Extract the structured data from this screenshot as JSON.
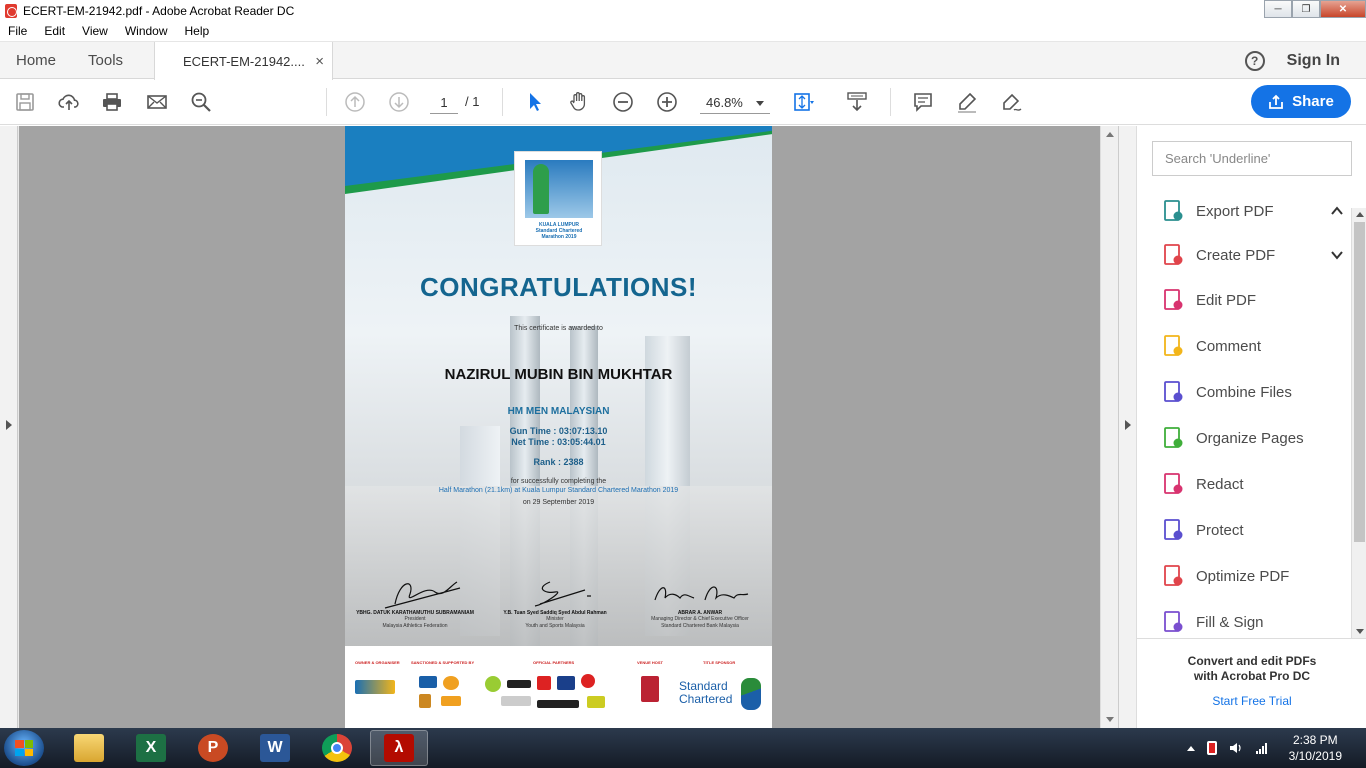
{
  "window": {
    "title": "ECERT-EM-21942.pdf - Adobe Acrobat Reader DC"
  },
  "menu": [
    "File",
    "Edit",
    "View",
    "Window",
    "Help"
  ],
  "tabs": {
    "home": "Home",
    "tools": "Tools",
    "doc": "ECERT-EM-21942....",
    "close": "×"
  },
  "header": {
    "help": "?",
    "signin": "Sign In"
  },
  "toolbar": {
    "page_current": "1",
    "page_total": "/ 1",
    "zoom": "46.8%",
    "share": "Share"
  },
  "certificate": {
    "logo_text": "KUALA LUMPUR\nStandard Chartered\nMarathon 2019",
    "headline": "CONGRATULATIONS!",
    "awarded": "This certificate is awarded to",
    "name": "NAZIRUL MUBIN BIN MUKHTAR",
    "category": "HM MEN MALAYSIAN",
    "gun_time": "Gun Time : 03:07:13.10",
    "net_time": "Net Time : 03:05:44.01",
    "rank": "Rank : 2388",
    "completing": "for successfully completing the",
    "event": "Half Marathon (21.1km) at Kuala Lumpur Standard Chartered Marathon 2019",
    "date": "on 29 September 2019",
    "signatories": [
      {
        "name": "YBHG. DATUK KARATHAMUTHU SUBRAMANIAM",
        "role1": "President",
        "role2": "Malaysia Athletics Federation"
      },
      {
        "name": "Y.B. Tuan Syed Saddiq Syed Abdul Rahman",
        "role1": "Minister",
        "role2": "Youth and Sports Malaysia"
      },
      {
        "name": "ABRAR A. ANWAR",
        "role1": "Managing Director & Chief Executive Officer",
        "role2": "Standard Chartered Bank Malaysia"
      }
    ],
    "sponsor_heads": [
      "OWNER & ORGANISER",
      "SANCTIONED & SUPPORTED BY",
      "OFFICIAL PARTNERS",
      "VENUE HOST",
      "TITLE SPONSOR"
    ],
    "sponsor_logo": "Standard\nChartered"
  },
  "right_panel": {
    "search_placeholder": "Search 'Underline'",
    "tools": [
      {
        "label": "Export PDF",
        "color": "#2a8f8f"
      },
      {
        "label": "Create PDF",
        "color": "#e0444b"
      },
      {
        "label": "Edit PDF",
        "color": "#d8336f"
      },
      {
        "label": "Comment",
        "color": "#f2b51a"
      },
      {
        "label": "Combine Files",
        "color": "#5a4fcf"
      },
      {
        "label": "Organize Pages",
        "color": "#3fae3a"
      },
      {
        "label": "Redact",
        "color": "#d8336f"
      },
      {
        "label": "Protect",
        "color": "#5a4fcf"
      },
      {
        "label": "Optimize PDF",
        "color": "#e0444b"
      },
      {
        "label": "Fill & Sign",
        "color": "#7a4fcf"
      }
    ],
    "promo": "Convert and edit PDFs\nwith Acrobat Pro DC",
    "trial": "Start Free Trial"
  },
  "taskbar": {
    "time": "2:38 PM",
    "date": "3/10/2019"
  }
}
